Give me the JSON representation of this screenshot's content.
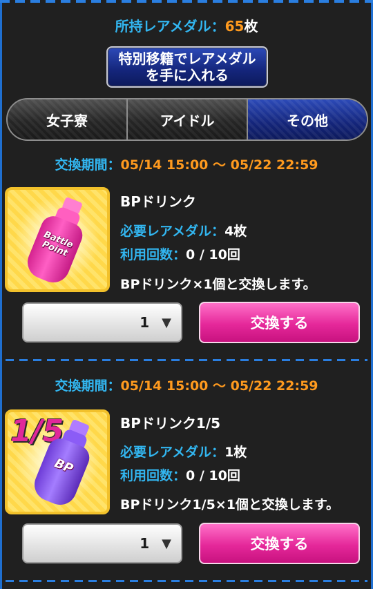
{
  "header": {
    "medal_label": "所持レアメダル：",
    "medal_count": "65",
    "medal_unit": "枚",
    "special_button_label": "特別移籍でレアメダルを手に入れる"
  },
  "tabs": [
    {
      "label": "女子寮",
      "active": false
    },
    {
      "label": "アイドル",
      "active": false
    },
    {
      "label": "その他",
      "active": true
    }
  ],
  "items": [
    {
      "period_label": "交換期間：",
      "period_value": "05/14 15:00 〜 05/22 22:59",
      "name": "BPドリンク",
      "required_label": "必要レアメダル：",
      "required_value": "4枚",
      "usage_label": "利用回数：",
      "usage_value": "0 / 10回",
      "description": "BPドリンク×1個と交換します。",
      "image_text": "Battle Point",
      "quantity": "1",
      "exchange_label": "交換する"
    },
    {
      "period_label": "交換期間：",
      "period_value": "05/14 15:00 〜 05/22 22:59",
      "name": "BPドリンク1/5",
      "required_label": "必要レアメダル：",
      "required_value": "1枚",
      "usage_label": "利用回数：",
      "usage_value": "0 / 10回",
      "description": "BPドリンク1/5×1個と交換します。",
      "image_text": "BP",
      "image_badge": "1/5",
      "quantity": "1",
      "exchange_label": "交換する"
    }
  ],
  "icons": {
    "dropdown_arrow": "▼"
  },
  "colors": {
    "label_blue": "#32b6f0",
    "value_orange": "#ff9a1e",
    "active_tab_blue": "#14257a",
    "exchange_pink": "#e5289a",
    "background": "#202020"
  }
}
